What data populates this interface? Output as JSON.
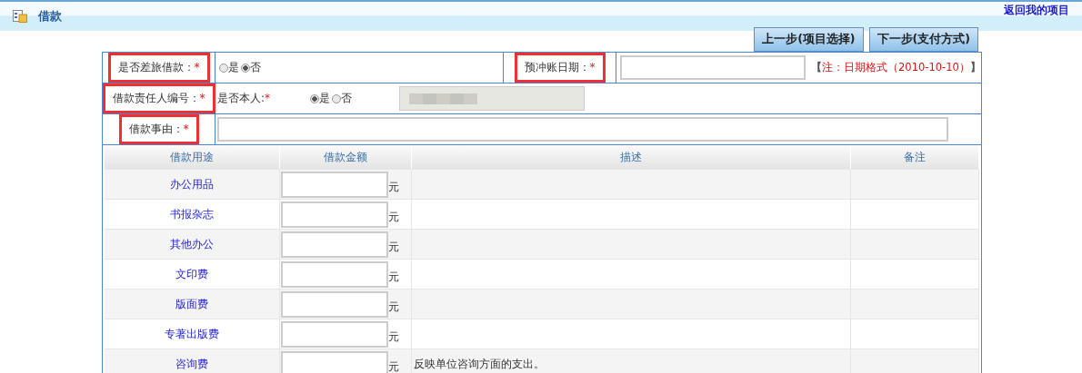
{
  "header": {
    "title": "借款",
    "back_link": "返回我的项目"
  },
  "buttons": [
    {
      "label": "上一步(项目选择)"
    },
    {
      "label": "下一步(支付方式)"
    }
  ],
  "form": {
    "travel_loan": {
      "label": "是否差旅借款：",
      "required_mark": "*",
      "highlighted": true,
      "options": [
        {
          "label": "是",
          "selected": false
        },
        {
          "label": "否",
          "selected": true
        }
      ]
    },
    "offset_date": {
      "label": "预冲账日期：",
      "required_mark": "*",
      "highlighted": true,
      "note_open": "【",
      "note": "注：日期格式（2010-10-10）",
      "note_close": "】"
    },
    "responsible_person": {
      "label": "借款责任人编号：",
      "required_mark": "*",
      "highlighted": true,
      "self_label": "是否本人:",
      "self_required_mark": "*",
      "options": [
        {
          "label": "是",
          "selected": true
        },
        {
          "label": "否",
          "selected": false
        }
      ],
      "id_field": {
        "blurred": true
      }
    },
    "reason": {
      "label": "借款事由：",
      "required_mark": "*",
      "highlighted": true
    }
  },
  "table": {
    "columns": [
      "借款用途",
      "借款金额",
      "描述",
      "备注"
    ],
    "rows": [
      {
        "purpose": "办公用品",
        "unit": "元"
      },
      {
        "purpose": "书报杂志",
        "unit": "元"
      },
      {
        "purpose": "其他办公",
        "unit": "元"
      },
      {
        "purpose": "文印费",
        "unit": "元"
      },
      {
        "purpose": "版面费",
        "unit": "元"
      },
      {
        "purpose": "专著出版费",
        "unit": "元"
      },
      {
        "purpose": "咨询费",
        "unit": "元",
        "description": "反映单位咨询方面的支出。"
      }
    ]
  }
}
